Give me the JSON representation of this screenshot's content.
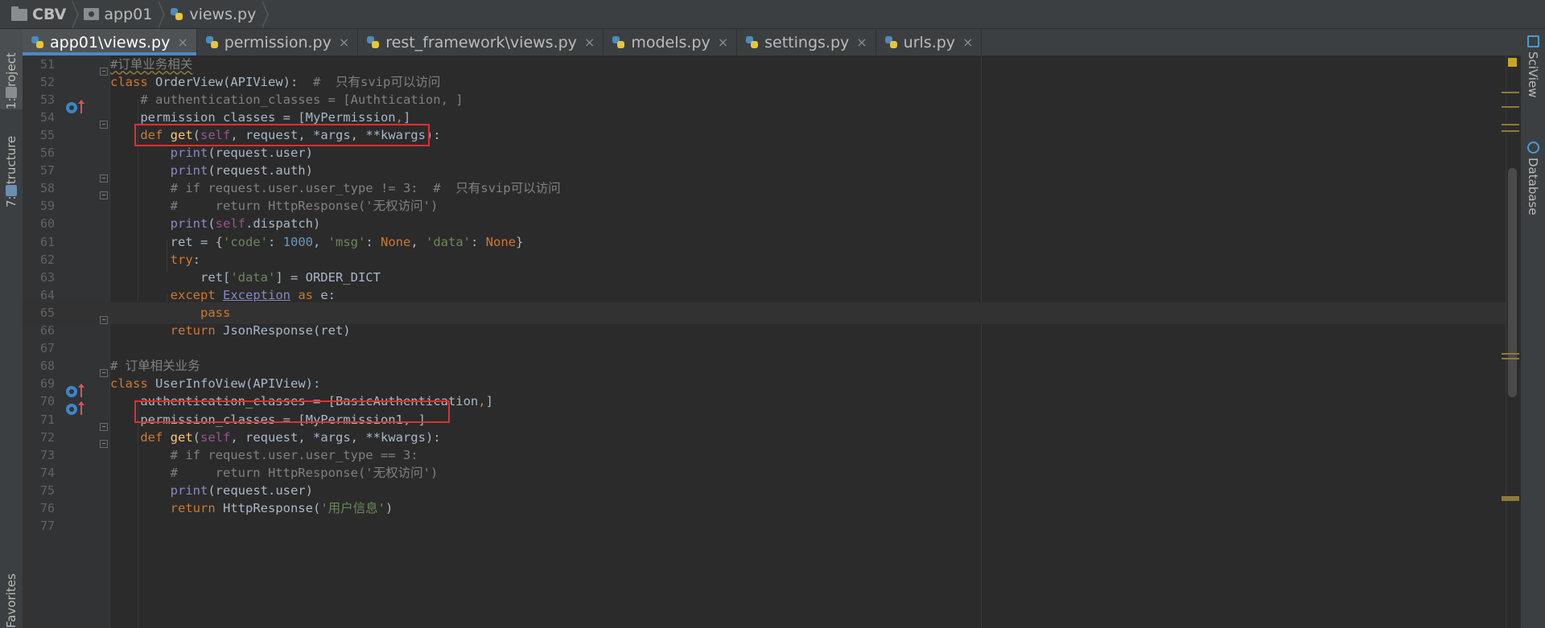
{
  "breadcrumb": [
    {
      "label": "CBV",
      "icon": "folder-icon"
    },
    {
      "label": "app01",
      "icon": "package-icon"
    },
    {
      "label": "views.py",
      "icon": "python-file-icon"
    }
  ],
  "tabs": [
    {
      "label": "app01\\views.py",
      "active": true
    },
    {
      "label": "permission.py",
      "active": false
    },
    {
      "label": "rest_framework\\views.py",
      "active": false
    },
    {
      "label": "models.py",
      "active": false
    },
    {
      "label": "settings.py",
      "active": false
    },
    {
      "label": "urls.py",
      "active": false
    }
  ],
  "tab_close_glyph": "×",
  "left_tools": {
    "project": "1: Project",
    "structure": "7: Structure",
    "favorites": "Favorites"
  },
  "right_tools": {
    "sciview": "SciView",
    "database": "Database"
  },
  "lines": [
    {
      "n": "51",
      "html": "<span class=\"c wavy\">#订单业务相关</span>"
    },
    {
      "n": "52",
      "html": "<span class=\"k\">class</span> <span class=\"cls\">OrderView</span>(APIView):  <span class=\"c\">#  只有svip可以访问</span>"
    },
    {
      "n": "53",
      "html": "    <span class=\"c\"># authentication_classes = [Authtication, ]</span>"
    },
    {
      "n": "54",
      "html": "    permission_classes = [MyPermission<span class=\"k\">,</span>]"
    },
    {
      "n": "55",
      "html": "    <span class=\"k\">def</span> <span class=\"fn\">get</span>(<span class=\"sf\">self</span>, request, *args, **kwargs):"
    },
    {
      "n": "56",
      "html": "        <span class=\"bi\">print</span>(request.user)"
    },
    {
      "n": "57",
      "html": "        <span class=\"bi\">print</span>(request.auth)"
    },
    {
      "n": "58",
      "html": "        <span class=\"c\"># if request.user.user_type != 3:  #  只有svip可以访问</span>"
    },
    {
      "n": "59",
      "html": "        <span class=\"c\">#     return HttpResponse('无权访问')</span>"
    },
    {
      "n": "60",
      "html": "        <span class=\"bi\">print</span>(<span class=\"sf\">self</span>.dispatch)"
    },
    {
      "n": "61",
      "html": "        ret = {<span class=\"s\">'code'</span>: <span class=\"n\">1000</span>, <span class=\"s\">'msg'</span>: <span class=\"k\">None</span>, <span class=\"s\">'data'</span>: <span class=\"k\">None</span>}"
    },
    {
      "n": "62",
      "html": "        <span class=\"k\">try</span>:"
    },
    {
      "n": "63",
      "html": "            ret[<span class=\"s\">'data'</span>] = ORDER_DICT"
    },
    {
      "n": "64",
      "html": "        <span class=\"k\">except</span> <span class=\"exc\">Exception</span> <span class=\"k\">as</span> e:"
    },
    {
      "n": "65",
      "html": "            <span class=\"k\">pass</span>"
    },
    {
      "n": "66",
      "html": "        <span class=\"k\">return</span> JsonResponse(ret)"
    },
    {
      "n": "67",
      "html": ""
    },
    {
      "n": "68",
      "html": "<span class=\"c\"># 订单相关业务</span>"
    },
    {
      "n": "69",
      "html": "<span class=\"k\">class</span> <span class=\"cls\">UserInfoView</span>(APIView):"
    },
    {
      "n": "70",
      "html": "    authentication_classes = [BasicAuthentication<span class=\"k\">,</span>]"
    },
    {
      "n": "71",
      "html": "    permission_classes = [MyPermission1, ]"
    },
    {
      "n": "72",
      "html": "    <span class=\"k\">def</span> <span class=\"fn\">get</span>(<span class=\"sf\">self</span>, request, *args, **kwargs):"
    },
    {
      "n": "73",
      "html": "        <span class=\"c\"># if request.user.user_type == 3:</span>"
    },
    {
      "n": "74",
      "html": "        <span class=\"c\">#     return HttpResponse('无权访问')</span>"
    },
    {
      "n": "75",
      "html": "        <span class=\"bi\">print</span>(request.user)"
    },
    {
      "n": "76",
      "html": "        <span class=\"k\">return</span> HttpResponse(<span class=\"s\">'用户信息'</span>)"
    },
    {
      "n": "77",
      "html": ""
    }
  ],
  "highlighted_lines": [
    "54",
    "71"
  ],
  "current_line": "65",
  "colors": {
    "keyword": "#cc7832",
    "comment": "#808080",
    "string": "#6a8759",
    "number": "#6897bb",
    "function": "#ffc66d",
    "highlight_box": "#e02f2f",
    "active_tab_underline": "#4a88c7"
  }
}
